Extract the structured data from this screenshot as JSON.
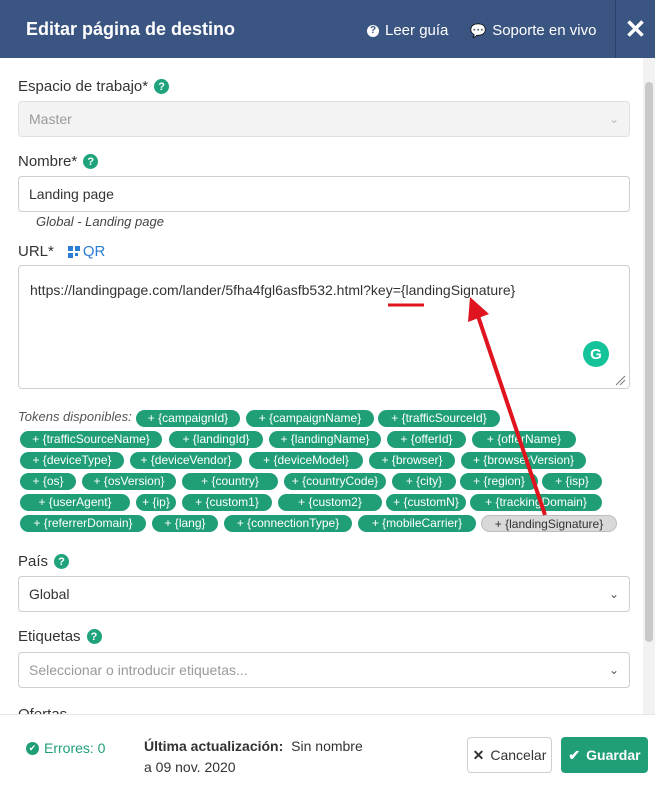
{
  "header": {
    "title": "Editar página de destino",
    "guide": "Leer guía",
    "support": "Soporte en vivo"
  },
  "workspace": {
    "label": "Espacio de trabajo*",
    "value": "Master"
  },
  "name": {
    "label": "Nombre*",
    "value": "Landing page",
    "hint": "Global - Landing page"
  },
  "url": {
    "label": "URL*",
    "qr": "QR",
    "value": "https://landingpage.com/lander/5fha4fgl6asfb532.html?key={landingSignature}"
  },
  "tokens": {
    "label": "Tokens disponibles:",
    "items": [
      "+ {campaignId}",
      "+ {campaignName}",
      "+ {trafficSourceId}",
      "+ {trafficSourceName}",
      "+ {landingId}",
      "+ {landingName}",
      "+ {offerId}",
      "+ {offerName}",
      "+ {deviceType}",
      "+ {deviceVendor}",
      "+ {deviceModel}",
      "+ {browser}",
      "+ {browserVersion}",
      "+ {os}",
      "+ {osVersion}",
      "+ {country}",
      "+ {countryCode}",
      "+ {city}",
      "+ {region}",
      "+ {isp}",
      "+ {userAgent}",
      "+ {ip}",
      "+ {custom1}",
      "+ {custom2}",
      "+ {customN}",
      "+ {trackingDomain}",
      "+ {referrerDomain}",
      "+ {lang}",
      "+ {connectionType}",
      "+ {mobileCarrier}",
      "+ {landingSignature}"
    ],
    "selected": "+ {landingSignature}"
  },
  "country": {
    "label": "País",
    "value": "Global"
  },
  "tags": {
    "label": "Etiquetas",
    "placeholder": "Seleccionar o introducir etiquetas..."
  },
  "offers": {
    "label": "Ofertas"
  },
  "footer": {
    "errors": "Errores: 0",
    "updated_label": "Última actualización:",
    "updated_by": "Sin nombre",
    "updated_date": "a 09 nov. 2020",
    "cancel": "Cancelar",
    "save": "Guardar"
  },
  "colors": {
    "header_bg": "#3b5582",
    "accent_green": "#1f9e78",
    "annotation_red": "#e0141e"
  }
}
